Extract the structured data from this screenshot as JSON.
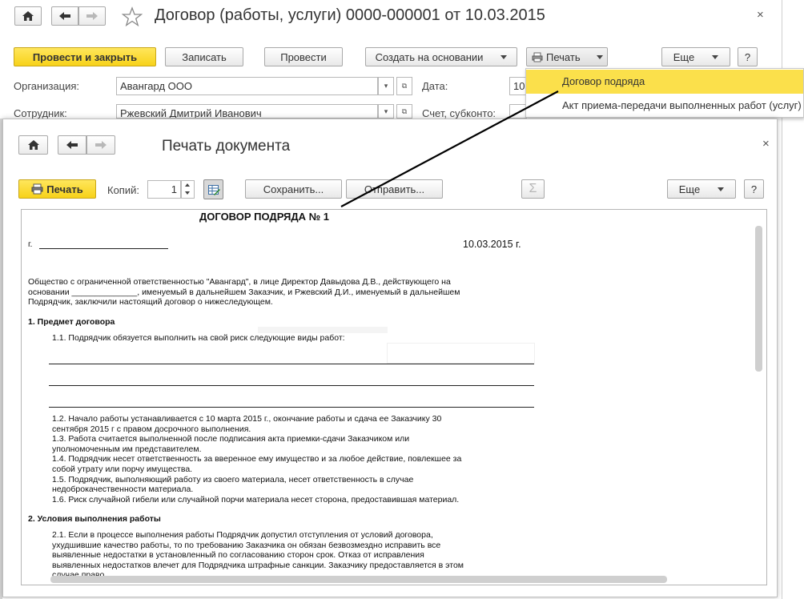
{
  "main_window": {
    "title": "Договор (работы, услуги) 0000-000001 от 10.03.2015",
    "close": "×",
    "toolbar": {
      "post_close": "Провести и закрыть",
      "save": "Записать",
      "post": "Провести",
      "create_based": "Создать на основании",
      "print": "Печать",
      "more": "Еще",
      "help": "?"
    },
    "fields": {
      "org_label": "Организация:",
      "org_value": "Авангард ООО",
      "date_label": "Дата:",
      "date_value": "10",
      "employee_label": "Сотрудник:",
      "employee_value": "Ржевский Дмитрий Иванович",
      "account_label": "Счет, субконто:"
    }
  },
  "print_menu": {
    "items": [
      "Договор подряда",
      "Акт приема-передачи выполненных работ (услуг)"
    ],
    "active_index": 0
  },
  "print_window": {
    "title": "Печать документа",
    "close": "×",
    "toolbar": {
      "print": "Печать",
      "copies_label": "Копий:",
      "copies_value": "1",
      "save": "Сохранить...",
      "send": "Отправить...",
      "sum": "Σ",
      "more": "Еще",
      "help": "?"
    },
    "document": {
      "heading": "ДОГОВОР ПОДРЯДА № 1",
      "city_prefix": "г.",
      "date": "10.03.2015 г.",
      "intro_lines": [
        "Общество с ограниченной ответственностью \"Авангард\", в лице Директор Давыдова Д.В., действующего на",
        "основании ______________, именуемый в дальнейшем Заказчик, и Ржевский Д.И., именуемый в дальнейшем",
        "Подрядчик, заключили настоящий договор о нижеследующем."
      ],
      "section1_title": "1. Предмет договора",
      "clause_1_1": "1.1. Подрядчик обязуется выполнить на свой риск следующие виды работ:",
      "section1_lines": [
        "1.2. Начало работы устанавливается с 10 марта 2015 г., окончание работы и сдача ее Заказчику 30",
        "сентября 2015 г с правом досрочного выполнения.",
        "1.3. Работа считается выполненной после подписания акта приемки-сдачи Заказчиком или",
        "уполномоченным им представителем.",
        "1.4. Подрядчик несет ответственность за вверенное ему имущество и за любое действие, повлекшее за",
        "собой утрату или порчу имущества.",
        "1.5. Подрядчик, выполняющий работу из своего материала, несет ответственность в случае",
        "недоброкачественности материала.",
        "1.6. Риск случайной гибели или случайной порчи материала несет сторона, предоставившая материал."
      ],
      "section2_title": "2. Условия выполнения работы",
      "section2_lines": [
        "2.1. Если в процессе выполнения работы Подрядчик допустил отступления от условий договора,",
        "ухудшившие качество работы, то по требованию Заказчика он обязан безвозмездно исправить все",
        "выявленные недостатки в установленный по согласованию сторон срок. Отказ от исправления",
        "выявленных недостатков влечет для Подрядчика штрафные санкции. Заказчику предоставляется в этом",
        "случае право..."
      ]
    }
  },
  "colors": {
    "accent_yellow": "#f7d219",
    "menu_highlight": "#fbe04b",
    "border": "#a9a9a9"
  }
}
